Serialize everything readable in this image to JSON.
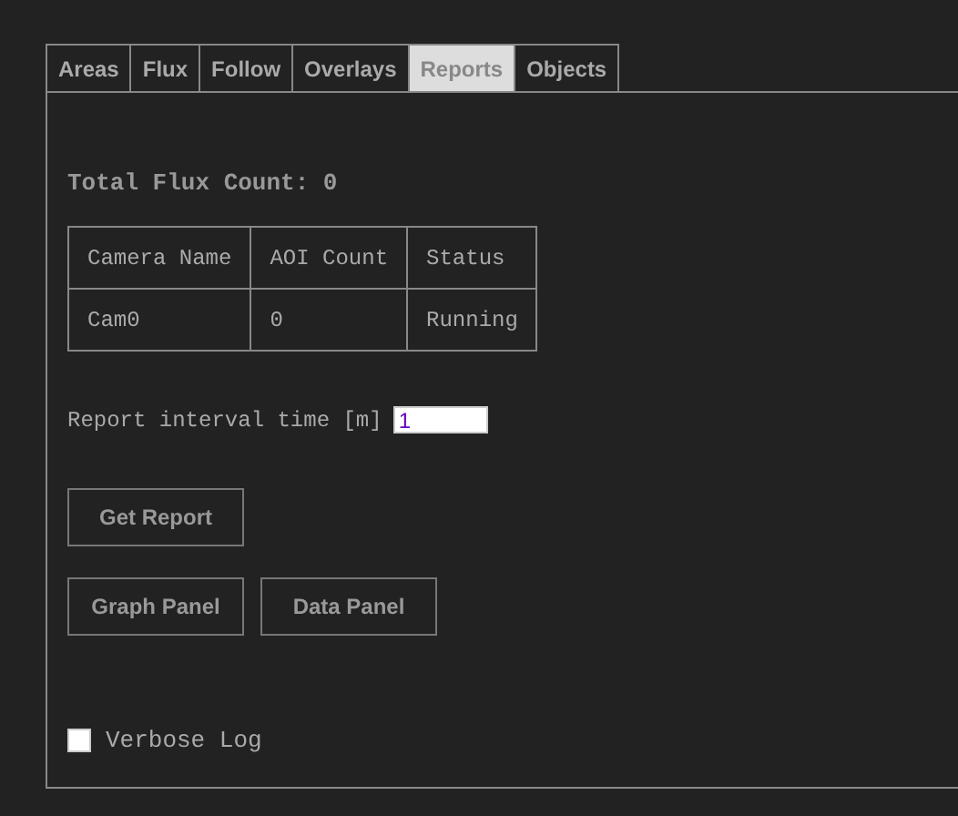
{
  "tabs": [
    {
      "label": "Areas",
      "selected": false
    },
    {
      "label": "Flux",
      "selected": false
    },
    {
      "label": "Follow",
      "selected": false
    },
    {
      "label": "Overlays",
      "selected": false
    },
    {
      "label": "Reports",
      "selected": true
    },
    {
      "label": "Objects",
      "selected": false
    }
  ],
  "total_flux": "Total Flux Count: 0",
  "table": {
    "columns": [
      "Camera Name",
      "AOI Count",
      "Status"
    ],
    "rows": [
      [
        "Cam0",
        "0",
        "Running"
      ]
    ]
  },
  "interval": {
    "label": "Report interval time [m]",
    "value": "1"
  },
  "buttons": [
    [
      "Get Report"
    ],
    [
      "Graph Panel",
      "Data Panel"
    ]
  ],
  "verbose": {
    "label": "Verbose Log",
    "checked": false
  }
}
